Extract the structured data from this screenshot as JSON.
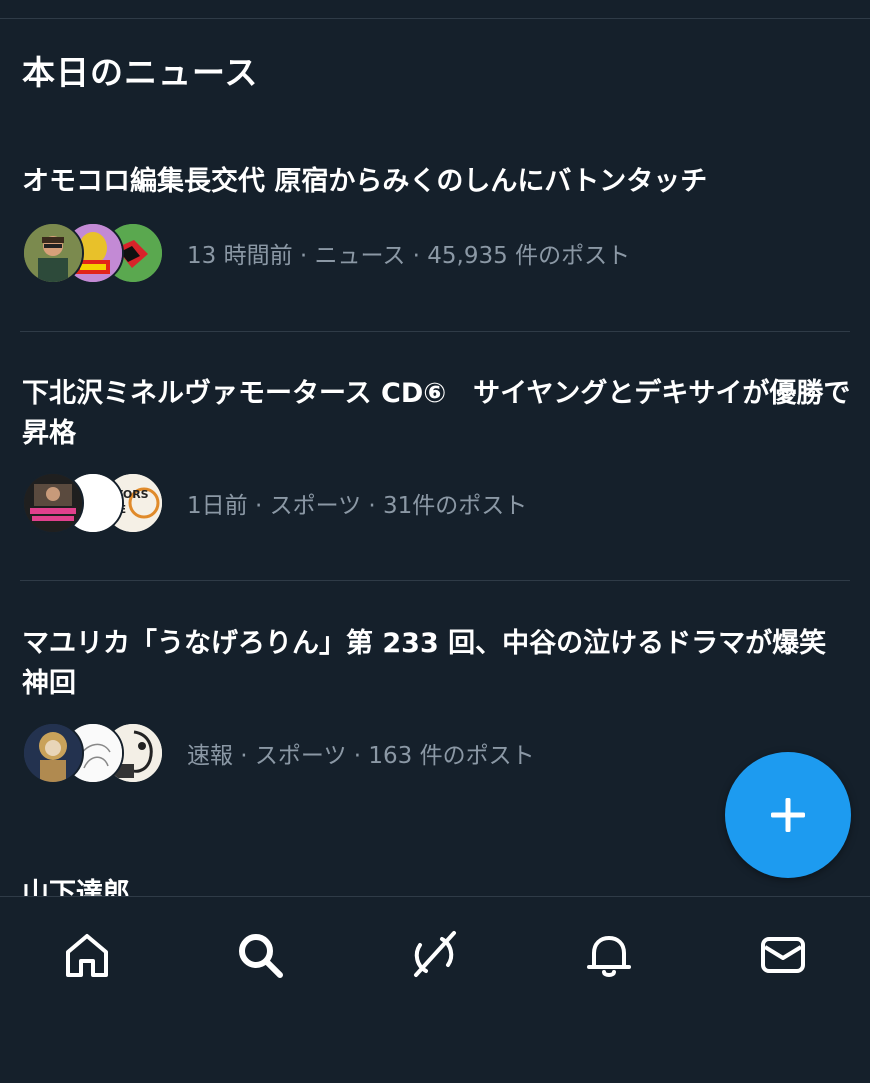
{
  "section": {
    "title": "本日のニュース"
  },
  "news_items": [
    {
      "headline": "オモコロ編集長交代 原宿からみくのしんにバトンタッチ",
      "meta": "13 時間前 · ニュース · 45,935 件のポスト"
    },
    {
      "headline": "下北沢ミネルヴァモータース CD⑥　サイヤングとデキサイが優勝で昇格",
      "meta": "1日前 · スポーツ · 31件のポスト",
      "avatar_text": "OTORS\nIVE"
    },
    {
      "headline": "マユリカ「うなげろりん」第 233 回、中谷の泣けるドラマが爆笑神回",
      "meta": "速報 · スポーツ · 163 件のポスト"
    }
  ],
  "partial_item": {
    "headline": "山下達郎"
  },
  "fab": {
    "icon": "plus-icon",
    "color": "#1d9bf0"
  },
  "bottom_nav": [
    {
      "name": "home",
      "icon": "home-icon"
    },
    {
      "name": "search",
      "icon": "search-icon"
    },
    {
      "name": "grok",
      "icon": "grok-icon"
    },
    {
      "name": "notifications",
      "icon": "bell-icon"
    },
    {
      "name": "messages",
      "icon": "mail-icon"
    }
  ],
  "colors": {
    "background": "#15202b",
    "meta_text": "#8b98a5",
    "accent": "#1d9bf0",
    "divider": "#2f3b47"
  }
}
